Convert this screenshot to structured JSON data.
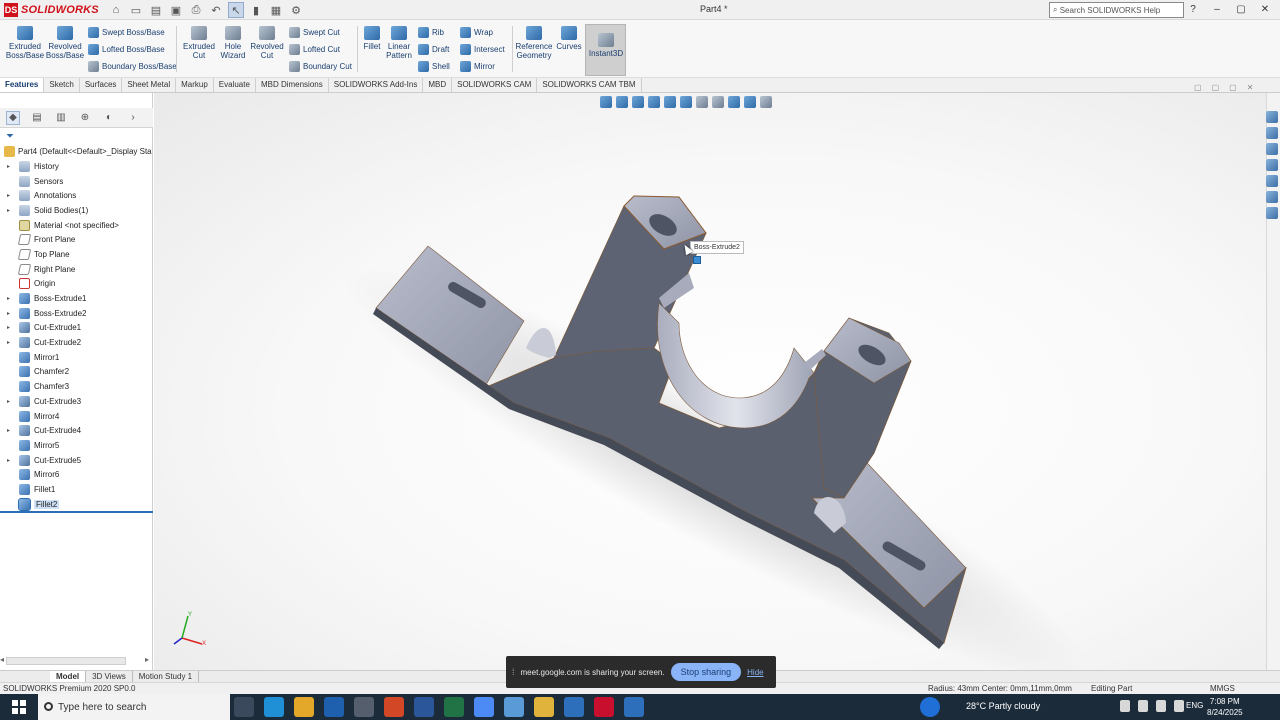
{
  "app": {
    "brand": "SOLIDWORKS",
    "document_title": "Part4 *",
    "search_placeholder": "Search SOLIDWORKS Help"
  },
  "ribbon": {
    "extruded_boss": "Extruded Boss/Base",
    "revolved_boss": "Revolved Boss/Base",
    "swept_boss": "Swept Boss/Base",
    "lofted_boss": "Lofted Boss/Base",
    "boundary_boss": "Boundary Boss/Base",
    "extruded_cut": "Extruded Cut",
    "hole_wizard": "Hole Wizard",
    "revolved_cut": "Revolved Cut",
    "swept_cut": "Swept Cut",
    "lofted_cut": "Lofted Cut",
    "boundary_cut": "Boundary Cut",
    "fillet": "Fillet",
    "linear_pattern": "Linear Pattern",
    "rib": "Rib",
    "draft": "Draft",
    "shell": "Shell",
    "wrap": "Wrap",
    "intersect": "Intersect",
    "mirror": "Mirror",
    "reference_geometry": "Reference Geometry",
    "curves": "Curves",
    "instant3d": "Instant3D"
  },
  "tabs": [
    "Features",
    "Sketch",
    "Surfaces",
    "Sheet Metal",
    "Markup",
    "Evaluate",
    "MBD Dimensions",
    "SOLIDWORKS Add-Ins",
    "MBD",
    "SOLIDWORKS CAM",
    "SOLIDWORKS CAM TBM"
  ],
  "tree": {
    "root": "Part4  (Default<<Default>_Display Sta",
    "items": [
      {
        "label": "History",
        "icon": "folder",
        "arrow": true
      },
      {
        "label": "Sensors",
        "icon": "folder",
        "arrow": false
      },
      {
        "label": "Annotations",
        "icon": "folder",
        "arrow": true
      },
      {
        "label": "Solid Bodies(1)",
        "icon": "folder",
        "arrow": true
      },
      {
        "label": "Material <not specified>",
        "icon": "material",
        "arrow": false
      },
      {
        "label": "Front Plane",
        "icon": "plane",
        "arrow": false
      },
      {
        "label": "Top Plane",
        "icon": "plane",
        "arrow": false
      },
      {
        "label": "Right Plane",
        "icon": "plane",
        "arrow": false
      },
      {
        "label": "Origin",
        "icon": "origin",
        "arrow": false
      },
      {
        "label": "Boss-Extrude1",
        "icon": "feature",
        "arrow": true
      },
      {
        "label": "Boss-Extrude2",
        "icon": "feature",
        "arrow": true
      },
      {
        "label": "Cut-Extrude1",
        "icon": "cut",
        "arrow": true
      },
      {
        "label": "Cut-Extrude2",
        "icon": "cut",
        "arrow": true
      },
      {
        "label": "Mirror1",
        "icon": "feature",
        "arrow": false
      },
      {
        "label": "Chamfer2",
        "icon": "feature",
        "arrow": false
      },
      {
        "label": "Chamfer3",
        "icon": "feature",
        "arrow": false
      },
      {
        "label": "Cut-Extrude3",
        "icon": "cut",
        "arrow": true
      },
      {
        "label": "Mirror4",
        "icon": "feature",
        "arrow": false
      },
      {
        "label": "Cut-Extrude4",
        "icon": "cut",
        "arrow": true
      },
      {
        "label": "Mirror5",
        "icon": "feature",
        "arrow": false
      },
      {
        "label": "Cut-Extrude5",
        "icon": "cut",
        "arrow": true
      },
      {
        "label": "Mirror6",
        "icon": "feature",
        "arrow": false
      },
      {
        "label": "Fillet1",
        "icon": "feature",
        "arrow": false
      },
      {
        "label": "Fillet2",
        "icon": "feature",
        "arrow": false,
        "selected": true
      }
    ]
  },
  "viewport": {
    "tooltip": "Boss-Extrude2",
    "part_color": "#5a606e"
  },
  "bottom_tabs": [
    "Model",
    "3D Views",
    "Motion Study 1"
  ],
  "status": {
    "product": "SOLIDWORKS Premium 2020 SP0.0",
    "radius": "Radius: 43mm  Center: 0mm,11mm,0mm",
    "mode": "Editing Part",
    "units": "MMGS"
  },
  "share": {
    "text": "meet.google.com is sharing your screen.",
    "stop": "Stop sharing",
    "hide": "Hide"
  },
  "taskbar": {
    "search": "Type here to search",
    "weather": "28°C  Partly cloudy",
    "lang": "ENG",
    "time": "7:08 PM",
    "date": "8/24/2025"
  }
}
